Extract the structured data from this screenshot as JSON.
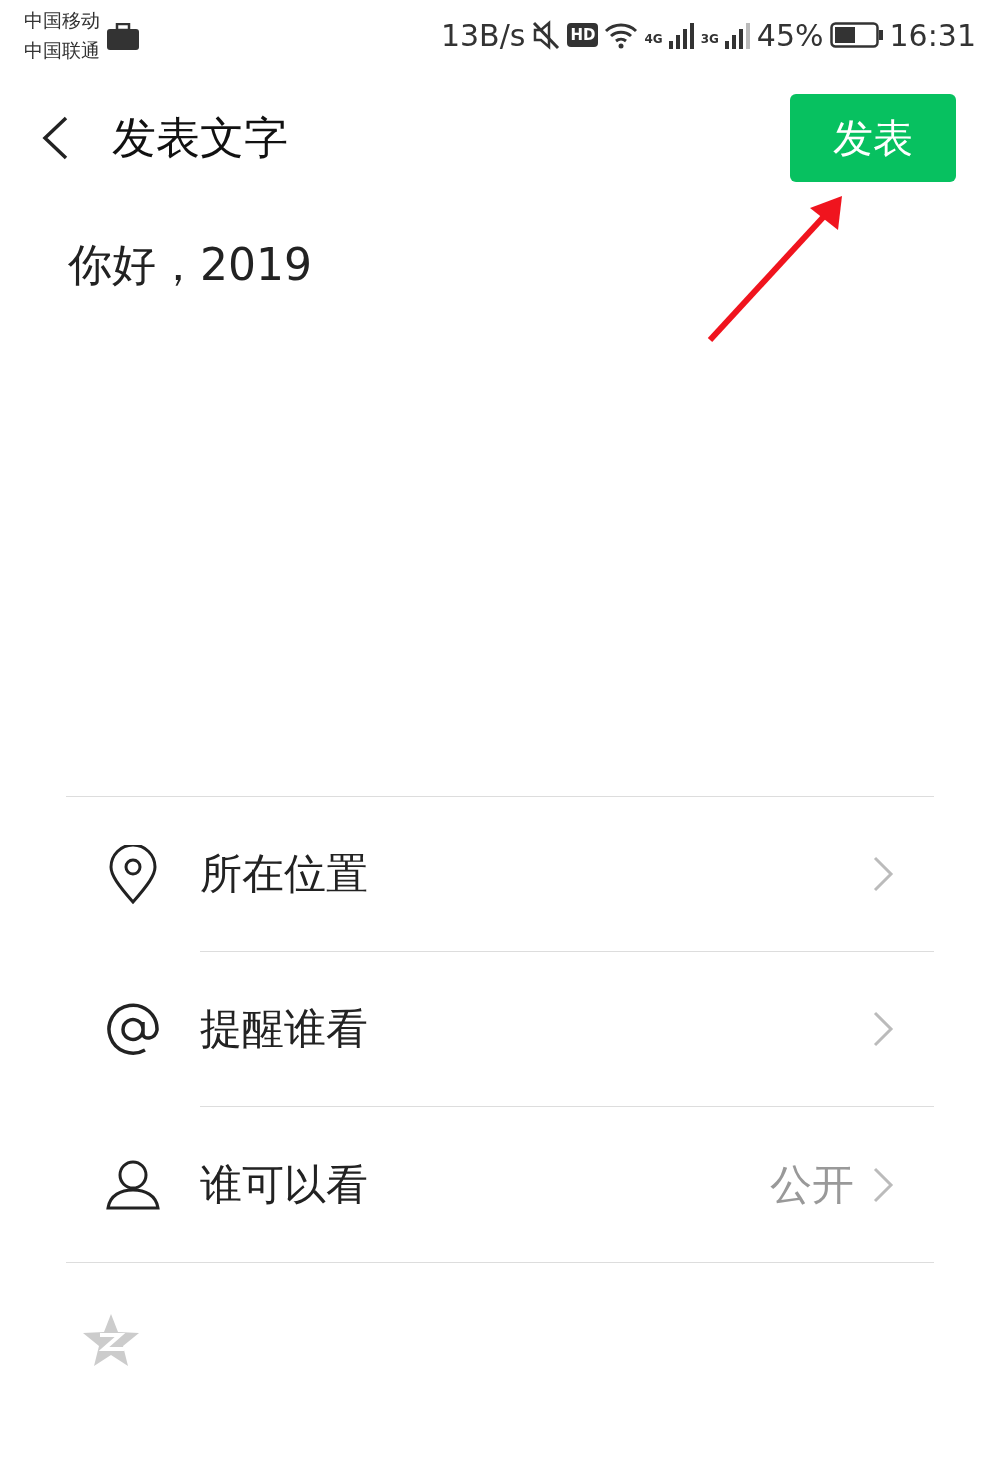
{
  "status_bar": {
    "carriers": [
      "中国移动",
      "中国联通"
    ],
    "speed": "13B/s",
    "hd": "HD",
    "networks": [
      "4G",
      "3G"
    ],
    "battery": "45%",
    "time": "16:31"
  },
  "header": {
    "title": "发表文字",
    "publish_button": "发表"
  },
  "post": {
    "text": "你好，2019"
  },
  "options": [
    {
      "kind": "location",
      "label": "所在位置"
    },
    {
      "kind": "mention",
      "label": "提醒谁看"
    },
    {
      "kind": "visibility",
      "label": "谁可以看",
      "value": "公开"
    }
  ]
}
